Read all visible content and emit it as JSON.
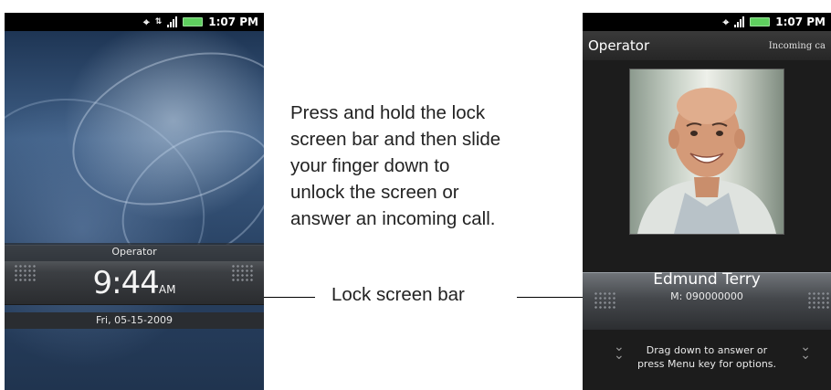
{
  "left_phone": {
    "status_time": "1:07 PM",
    "operator": "Operator",
    "time": "9:44",
    "ampm": "AM",
    "date": "Fri, 05-15-2009"
  },
  "right_phone": {
    "status_time": "1:07 PM",
    "operator": "Operator",
    "call_status": "Incoming ca",
    "caller_name": "Edmund Terry",
    "caller_number": "M: 090000000",
    "drag_hint_line1": "Drag down to answer or",
    "drag_hint_line2": "press Menu key for options."
  },
  "instructions": "Press and hold the lock\nscreen bar and then slide\nyour finger down to\nunlock the screen or\nanswer an incoming call.",
  "callout_label": "Lock screen bar",
  "colors": {
    "battery": "#5fcf5f",
    "lock_bar": "#3c3f43"
  }
}
